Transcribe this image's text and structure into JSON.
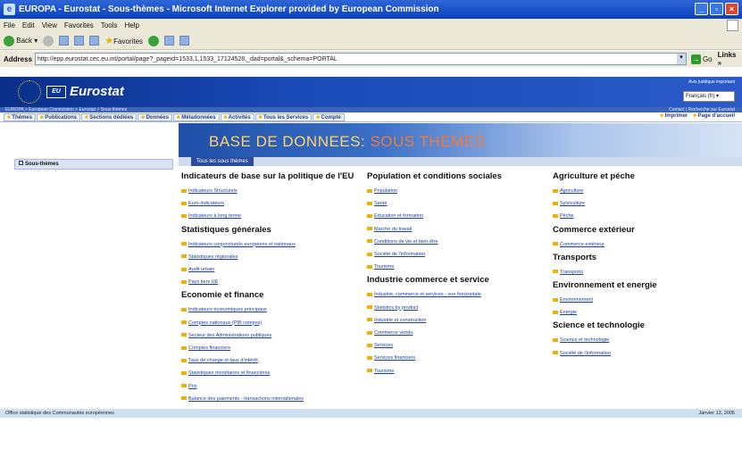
{
  "window": {
    "title": "EUROPA - Eurostat - Sous-thèmes - Microsoft Internet Explorer provided by European Commission"
  },
  "menu": [
    "File",
    "Edit",
    "View",
    "Favorites",
    "Tools",
    "Help"
  ],
  "toolbar": {
    "back": "Back",
    "favorites": "Favorites"
  },
  "address": {
    "label": "Address",
    "url": "http://epp.eurostat.cec.eu.int/portal/page?_pageid=1533,1,1533_17124528,_dad=portal&_schema=PORTAL",
    "go": "Go",
    "links": "Links"
  },
  "header": {
    "brand": "Eurostat",
    "eu_box": "EU",
    "legal": "Avis juridique important",
    "language": "Français (fr)"
  },
  "crumb": {
    "left": "EUROPA > European Commission > Eurostat > Sous-thèmes",
    "right": "Contact | Recherche sur Eurostat"
  },
  "nav": {
    "items": [
      "Thèmes",
      "Publications",
      "Sections dédiées",
      "Données",
      "Métadonnées",
      "Activités",
      "Tous les Services",
      "Compte"
    ],
    "print": "Imprimer",
    "home": "Page d'accueil"
  },
  "hero": {
    "title_main": "BASE DE DONNEES: ",
    "title_sub": "SOUS THEMES"
  },
  "tab": "Tous les sous thèmes",
  "side": "Sous-thèmes",
  "columns": [
    {
      "groups": [
        {
          "title": "Indicateurs de base sur la politique de l'EU",
          "links": [
            "Indicateurs Structurels",
            "Euro-indicateurs",
            "Indicateurs à long terme"
          ]
        },
        {
          "title": "Statistiques générales",
          "links": [
            "Indicateurs conjoncturels européens et nationaux",
            "Statistiques régionales",
            "Audit urbain",
            "Pays tiers UE"
          ]
        },
        {
          "title": "Economie et finance",
          "links": [
            "Indicateurs économiques principaux",
            "Comptes nationaux (PIB compris)",
            "Secteur des Administrations publiques",
            "Comptes financiers",
            "Taux de change et taux d'intérêt",
            "Statistiques monétaires et financières",
            "Prix",
            "Balance des paiements - transactions internationales"
          ]
        }
      ]
    },
    {
      "groups": [
        {
          "title": "Population et conditions sociales",
          "links": [
            "Population",
            "Santé",
            "Education et formation",
            "Marché du travail",
            "Conditions de vie et bien-être",
            "Société de l'information",
            "Tourisme"
          ]
        },
        {
          "title": "Industrie commerce et service",
          "links": [
            "Industrie, commerce et services - vue horizontale",
            "Statistics by product",
            "Industrie et construction",
            "Commerce vendu",
            "Services",
            "Services financiers",
            "Tourisme"
          ]
        }
      ]
    },
    {
      "groups": [
        {
          "title": "Agriculture et péche",
          "links": [
            "Agriculture",
            "Sylviculture",
            "Pêche"
          ]
        },
        {
          "title": "Commerce extérieur",
          "links": [
            "Commerce extérieur"
          ]
        },
        {
          "title": "Transports",
          "links": [
            "Transports"
          ]
        },
        {
          "title": "Environnement et energie",
          "links": [
            "Environnement",
            "Energie"
          ]
        },
        {
          "title": "Science et technologie",
          "links": [
            "Science et technologie",
            "Société de l'information"
          ]
        }
      ]
    }
  ],
  "footer": {
    "left": "Office statistique des Communautés européennes",
    "right": "Janvier 13, 2005"
  }
}
